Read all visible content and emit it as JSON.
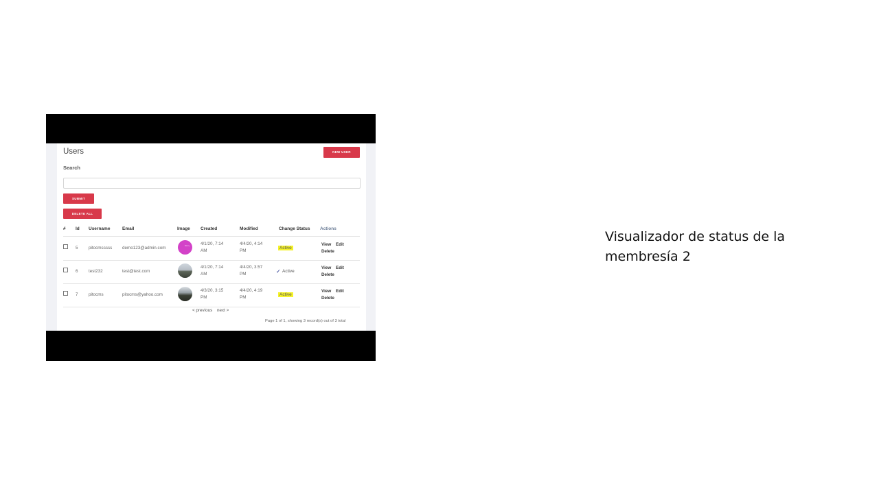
{
  "page": {
    "title": "Users",
    "new_user_label": "NEW USER",
    "search_label": "Search",
    "search_placeholder": "",
    "submit_label": "SUBMIT",
    "delete_all_label": "DELETE ALL"
  },
  "table": {
    "headers": {
      "num": "#",
      "id": "Id",
      "username": "Username",
      "email": "Email",
      "image": "Image",
      "created": "Created",
      "modified": "Modified",
      "change_status": "Change Status",
      "actions": "Actions"
    },
    "rows": [
      {
        "id": "5",
        "username": "pitocmsssss",
        "email": "demo123@admin.com",
        "image": "pink-avatar",
        "image_text": "Roccy",
        "created_1": "4/1/20, 7:14",
        "created_2": "AM",
        "modified_1": "4/4/20, 4:14",
        "modified_2": "PM",
        "status": "Active",
        "view": "View",
        "edit": "Edit",
        "delete": "Delete"
      },
      {
        "id": "6",
        "username": "test232",
        "email": "test@test.com",
        "image": "landscape-avatar",
        "created_1": "4/1/20, 7:14",
        "created_2": "AM",
        "modified_1": "4/4/20, 3:57",
        "modified_2": "PM",
        "status": "Active",
        "view": "View",
        "edit": "Edit",
        "delete": "Delete"
      },
      {
        "id": "7",
        "username": "pitocms",
        "email": "pitocms@yahoo.com",
        "image": "landscape-avatar",
        "created_1": "4/3/20, 3:15",
        "created_2": "PM",
        "modified_1": "4/4/20, 4:19",
        "modified_2": "PM",
        "status": "Active",
        "view": "View",
        "edit": "Edit",
        "delete": "Delete"
      }
    ]
  },
  "pagination": {
    "previous": "< previous",
    "next": "next >",
    "info": "Page 1 of 1, showing 3 record(s) out of 3 total"
  },
  "caption": "Visualizador de status de la membresía 2",
  "colors": {
    "accent_red": "#d8394a",
    "highlight_yellow": "#f5f22a"
  }
}
